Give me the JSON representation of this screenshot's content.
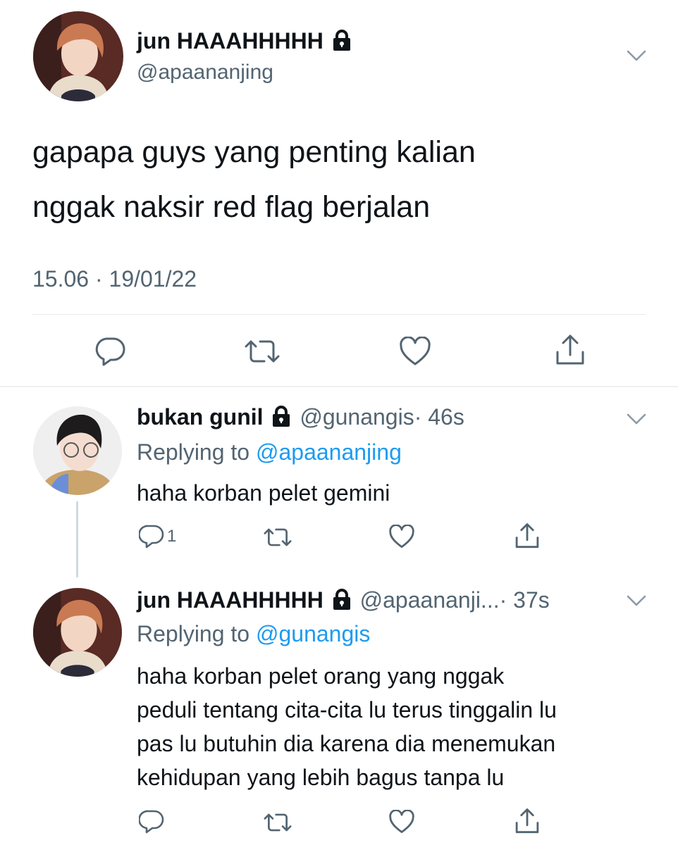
{
  "main_tweet": {
    "display_name": "jun HAAAHHHHH",
    "handle": "@apaananjing",
    "text_line1": "gapapa guys yang penting kalian",
    "text_line2": "nggak naksir red flag berjalan",
    "timestamp": "15.06 · 19/01/22"
  },
  "reply1": {
    "display_name": "bukan gunil",
    "handle": "@gunangis",
    "time": "· 46s",
    "replying_prefix": "Replying to",
    "replying_to": "@apaananjing",
    "text": "haha korban pelet gemini",
    "reply_count": "1"
  },
  "reply2": {
    "display_name": "jun HAAAHHHHH",
    "handle": "@apaananji...",
    "time": "· 37s",
    "replying_prefix": "Replying to",
    "replying_to": "@gunangis",
    "text_line1": "haha korban pelet orang yang nggak",
    "text_line2": "peduli tentang cita-cita lu terus tinggalin lu",
    "text_line3": "pas lu butuhin dia karena dia menemukan",
    "text_line4": "kehidupan yang lebih bagus tanpa lu"
  },
  "icons": [
    "lock-icon",
    "chevron-down-icon",
    "reply-icon",
    "retweet-icon",
    "like-icon",
    "share-icon"
  ],
  "colors": {
    "link": "#1d9bf0",
    "muted": "#536471",
    "text": "#0f1419"
  }
}
